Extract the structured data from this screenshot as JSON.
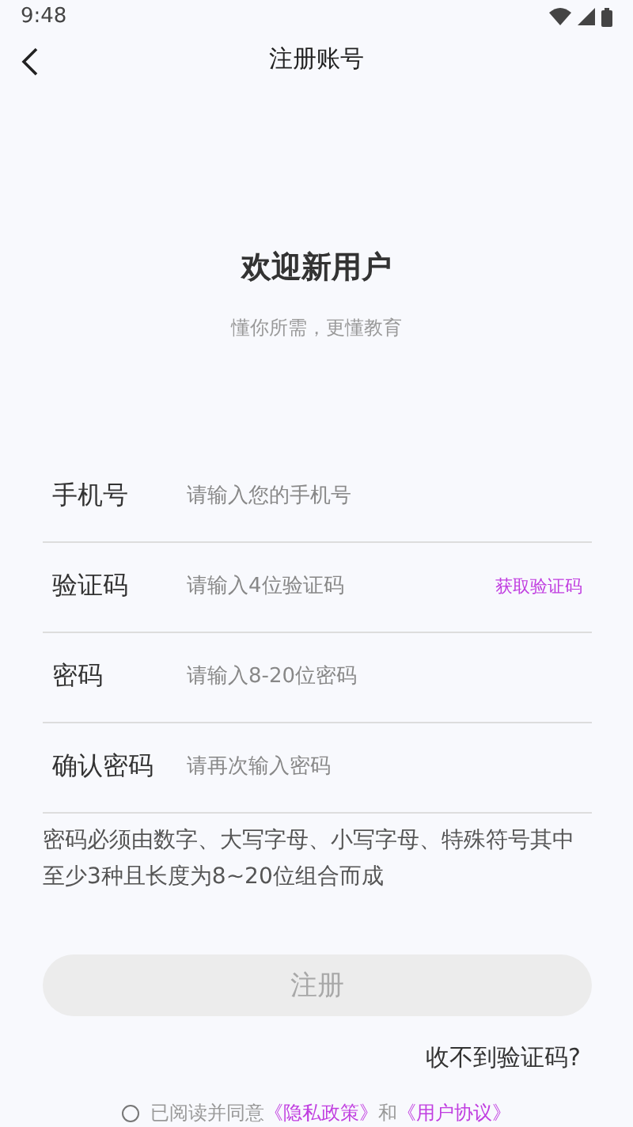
{
  "status_bar": {
    "time": "9:48"
  },
  "header": {
    "title": "注册账号"
  },
  "welcome": {
    "title": "欢迎新用户",
    "subtitle": "懂你所需，更懂教育"
  },
  "fields": [
    {
      "label": "手机号",
      "placeholder": "请输入您的手机号"
    },
    {
      "label": "验证码",
      "placeholder": "请输入4位验证码",
      "action": "获取验证码"
    },
    {
      "label": "密码",
      "placeholder": "请输入8-20位密码"
    },
    {
      "label": "确认密码",
      "placeholder": "请再次输入密码"
    }
  ],
  "hint": "密码必须由数字、大写字母、小写字母、特殊符号其中至少3种且长度为8~20位组合而成",
  "register_button": {
    "label": "注册",
    "disabled": true
  },
  "no_code_link": "收不到验证码?",
  "agreement": {
    "checked": false,
    "text": "已阅读并同意",
    "link_1": "《隐私政策》",
    "joiner": "和",
    "link_2": "《用户协议》"
  }
}
